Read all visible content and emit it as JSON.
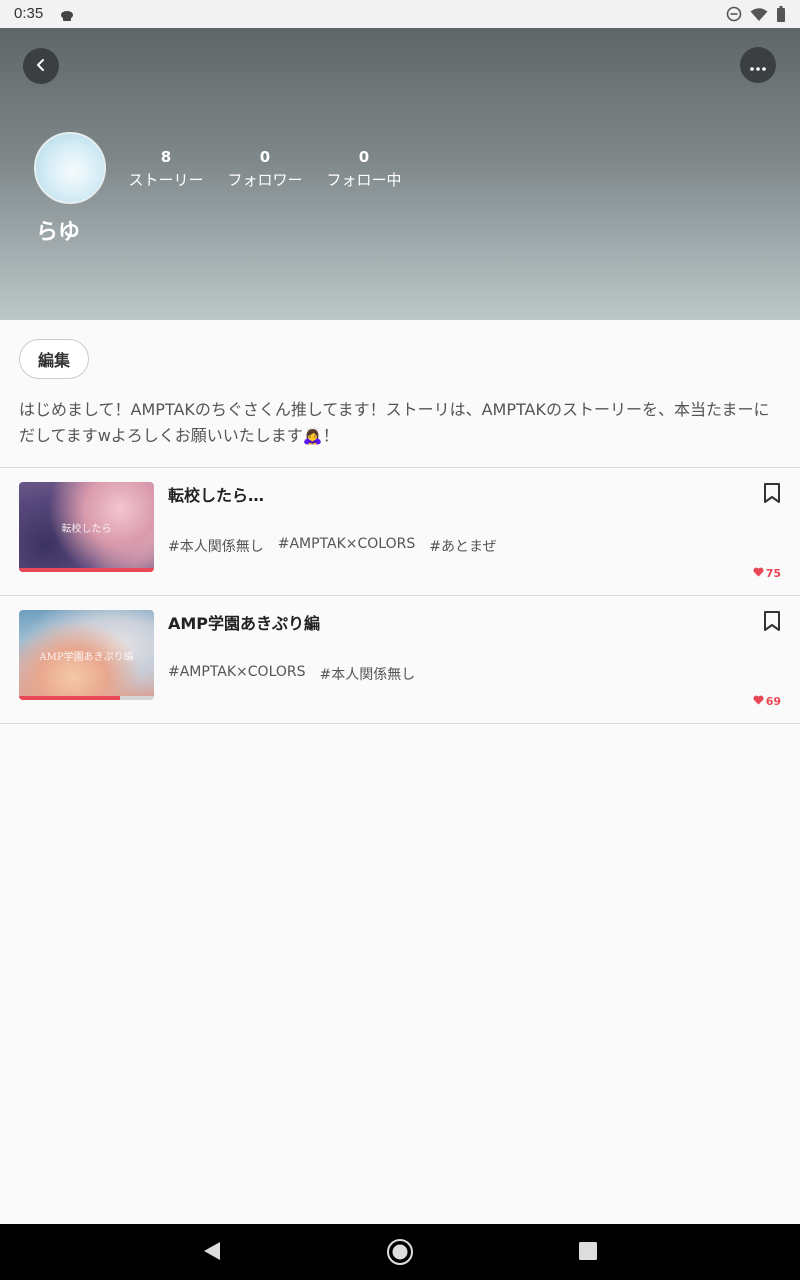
{
  "status": {
    "time": "0:35"
  },
  "profile": {
    "username": "らゆ",
    "stats": [
      {
        "num": "8",
        "label": "ストーリー"
      },
      {
        "num": "0",
        "label": "フォロワー"
      },
      {
        "num": "0",
        "label": "フォロー中"
      }
    ],
    "edit_label": "編集",
    "bio_line1": "はじめまして！AMPTAKのちぐさくん推してます！ストーリは、AMPTAKのストーリーを、本当たまーに",
    "bio_line2": "だしてますwよろしくお願いいたします🙇‍♀️！"
  },
  "stories": [
    {
      "title": "転校したら…",
      "thumb_text": "転校したら",
      "tags": [
        "#本人関係無し",
        "#AMPTAK×COLORS",
        "#あとまぜ"
      ],
      "likes": "75",
      "progress": 1.0
    },
    {
      "title": "AMP学園あきぷり編",
      "thumb_text": "AMP学園あきぷり編",
      "tags": [
        "#AMPTAK×COLORS",
        "#本人関係無し"
      ],
      "likes": "69",
      "progress": 0.75
    }
  ],
  "colors": {
    "accent": "#e84855",
    "header_top": "#5f6668",
    "header_bottom": "#bcc7c8"
  },
  "icons": [
    "back-icon",
    "more-icon",
    "bookmark-icon",
    "heart-icon",
    "nav-back-icon",
    "nav-home-icon",
    "nav-recents-icon"
  ]
}
